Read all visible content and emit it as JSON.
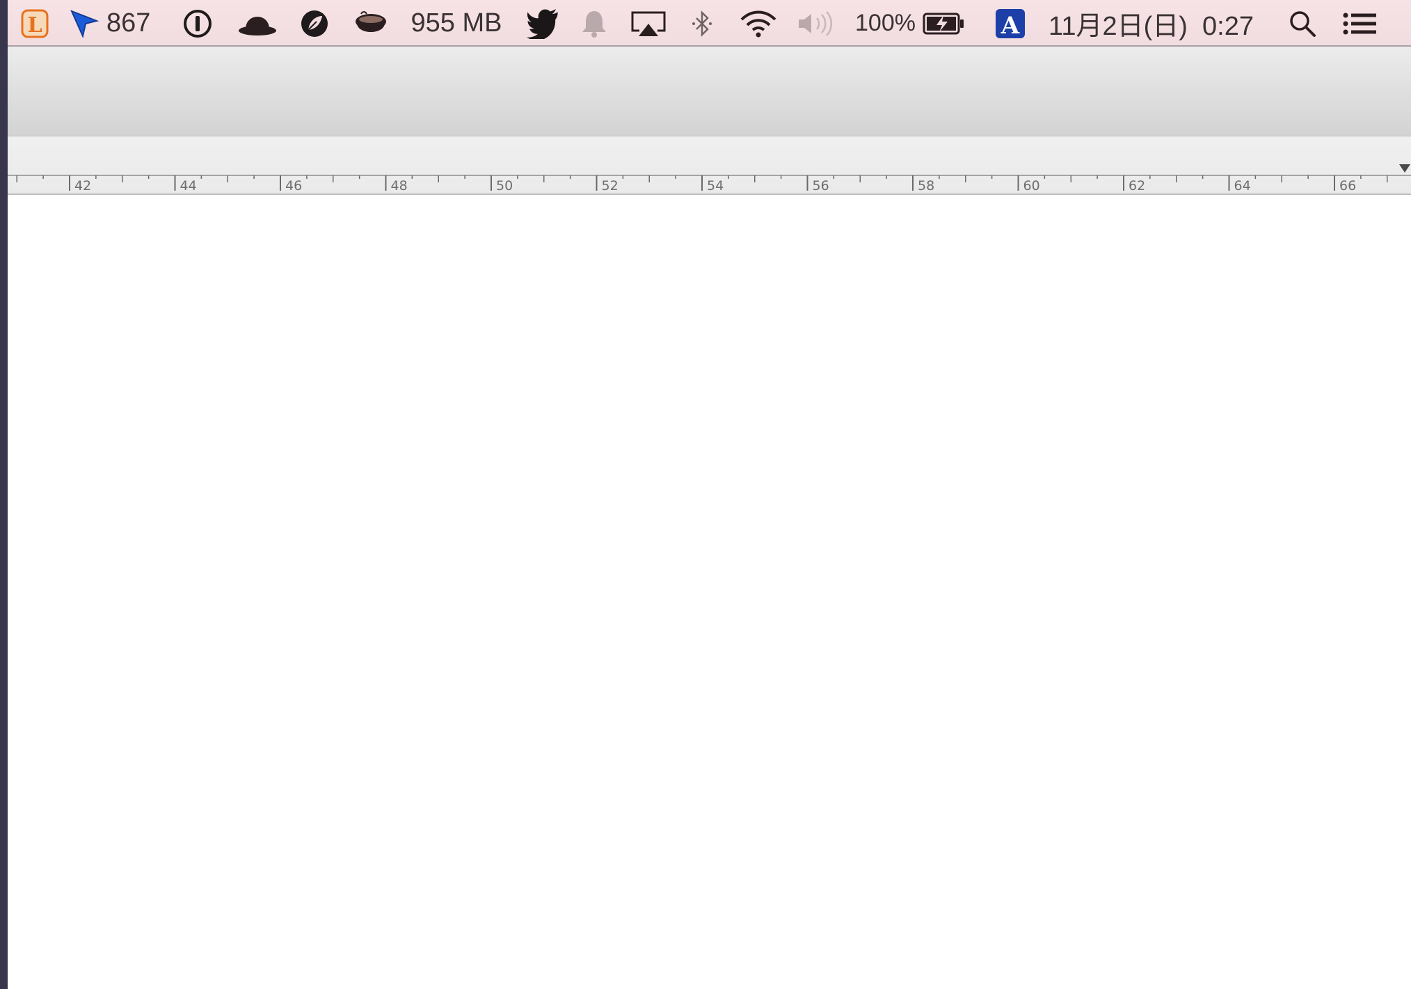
{
  "menubar": {
    "items": [
      {
        "id": "l",
        "icon": "lingo-l-icon"
      },
      {
        "id": "cursor",
        "icon": "cursor-arrow-icon",
        "text": "867"
      },
      {
        "id": "onepass",
        "icon": "one-password-icon"
      },
      {
        "id": "hat",
        "icon": "bowler-hat-icon"
      },
      {
        "id": "leaf",
        "icon": "leaf-icon"
      },
      {
        "id": "coffee",
        "icon": "coffee-cup-icon"
      },
      {
        "id": "memory",
        "text": "955 MB"
      },
      {
        "id": "twitter",
        "icon": "twitter-bird-icon"
      },
      {
        "id": "bell",
        "icon": "notification-bell-icon"
      },
      {
        "id": "airplay",
        "icon": "airplay-icon"
      },
      {
        "id": "bluetooth",
        "icon": "bluetooth-icon"
      },
      {
        "id": "wifi",
        "icon": "wifi-icon"
      },
      {
        "id": "volume",
        "icon": "volume-icon"
      },
      {
        "id": "battery",
        "icon": "battery-charging-icon",
        "text": "100%"
      },
      {
        "id": "input",
        "icon": "input-source-a-icon"
      },
      {
        "id": "clock",
        "text": "11月2日(日)  0:27"
      },
      {
        "id": "spotlight",
        "icon": "spotlight-search-icon"
      },
      {
        "id": "notifications",
        "icon": "notification-center-icon"
      }
    ],
    "cursor_count": "867",
    "memory": "955 MB",
    "battery_percent": "100%",
    "clock": "11月2日(日)  0:27"
  },
  "ruler": {
    "labels": [
      "42",
      "44",
      "46",
      "48",
      "50",
      "52",
      "54",
      "56",
      "58",
      "60",
      "62",
      "64",
      "66"
    ]
  },
  "colors": {
    "menubar_bg": "#f4e0e3",
    "twitter_blue": "#1a1a1a",
    "cursor_blue": "#1e5bd8",
    "lingo_orange": "#e8701e",
    "input_blue": "#1d3fa8"
  }
}
